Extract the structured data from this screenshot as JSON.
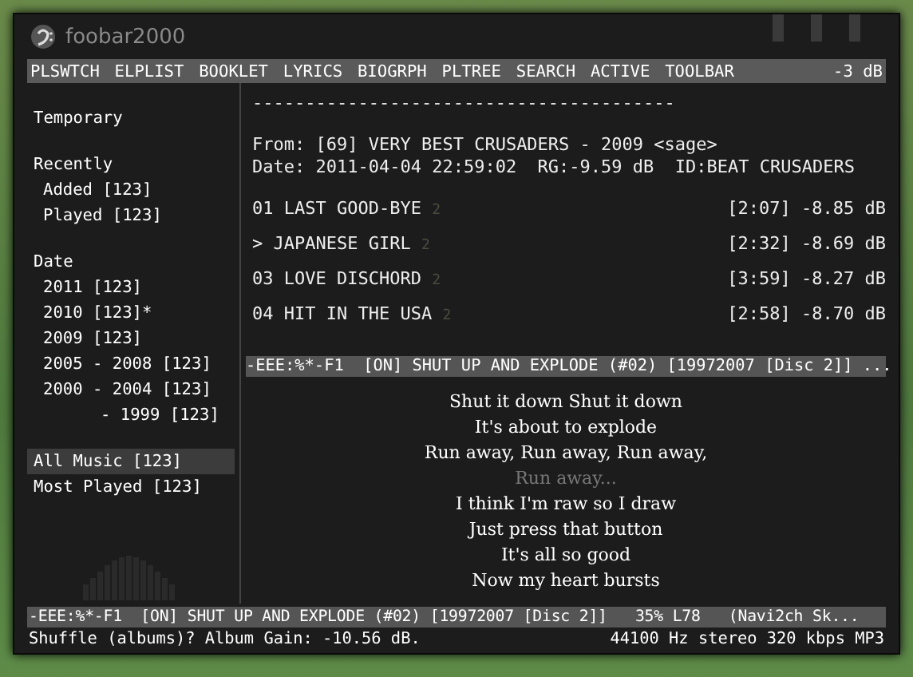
{
  "window": {
    "title": "foobar2000"
  },
  "menu": {
    "items": [
      "PLSWTCH",
      "ELPLIST",
      "BOOKLET",
      "LYRICS",
      "BIOGRPH",
      "PLTREE",
      "SEARCH",
      "ACTIVE",
      "TOOLBAR"
    ],
    "volume": "-3 dB"
  },
  "sidebar": {
    "groups": [
      {
        "label": "Temporary",
        "selected": false
      },
      {
        "label": "Recently",
        "selected": false,
        "children": [
          {
            "label": "Added [123]",
            "selected": false
          },
          {
            "label": "Played [123]",
            "selected": false
          }
        ]
      },
      {
        "label": "Date",
        "selected": false,
        "children": [
          {
            "label": "2011 [123]",
            "selected": false
          },
          {
            "label": "2010 [123]*",
            "selected": false
          },
          {
            "label": "2009 [123]",
            "selected": false
          },
          {
            "label": "2005 - 2008 [123]",
            "selected": false
          },
          {
            "label": "2000 - 2004 [123]",
            "selected": false
          },
          {
            "label": "- 1999 [123]",
            "selected": false,
            "kind": "range-end"
          }
        ]
      },
      {
        "label": "All Music [123]",
        "selected": true
      },
      {
        "label": "Most Played [123]",
        "selected": false
      }
    ]
  },
  "album": {
    "rule": "----------------------------------------",
    "from": "From: [69] VERY BEST CRUSADERS - 2009 <sage>",
    "date": "Date: 2011-04-04 22:59:02  RG:-9.59 dB  ID:BEAT CRUSADERS"
  },
  "tracks": [
    {
      "number": "01",
      "title": "LAST GOOD-BYE",
      "mark": "2",
      "length": "[2:07]",
      "gain": "-8.85 dB"
    },
    {
      "number": ">",
      "title": "JAPANESE GIRL",
      "mark": "2",
      "length": "[2:32]",
      "gain": "-8.69 dB"
    },
    {
      "number": "03",
      "title": "LOVE DISCHORD",
      "mark": "2",
      "length": "[3:59]",
      "gain": "-8.27 dB"
    },
    {
      "number": "04",
      "title": "HIT IN THE USA",
      "mark": "2",
      "length": "[2:58]",
      "gain": "-8.70 dB"
    }
  ],
  "playlist_modeline": "-EEE:%*-F1  [ON] SHUT UP AND EXPLODE (#02) [19972007 [Disc 2]] ...",
  "lyrics": [
    {
      "text": "Shut it down Shut it down",
      "dim": false
    },
    {
      "text": "It's about to explode",
      "dim": false
    },
    {
      "text": "Run away, Run away, Run away,",
      "dim": false
    },
    {
      "text": "Run away...",
      "dim": true
    },
    {
      "text": "I think I'm raw so I draw",
      "dim": false
    },
    {
      "text": "Just press that button",
      "dim": false
    },
    {
      "text": "It's all so good",
      "dim": false
    },
    {
      "text": "Now my heart bursts",
      "dim": false
    }
  ],
  "modeline": "-EEE:%*-F1  [ON] SHUT UP AND EXPLODE (#02) [19972007 [Disc 2]]   35% L78   (Navi2ch Sk...",
  "status_bar": {
    "left": "Shuffle (albums)? Album Gain: -10.56 dB.",
    "right": "44100 Hz stereo 320 kbps MP3"
  }
}
